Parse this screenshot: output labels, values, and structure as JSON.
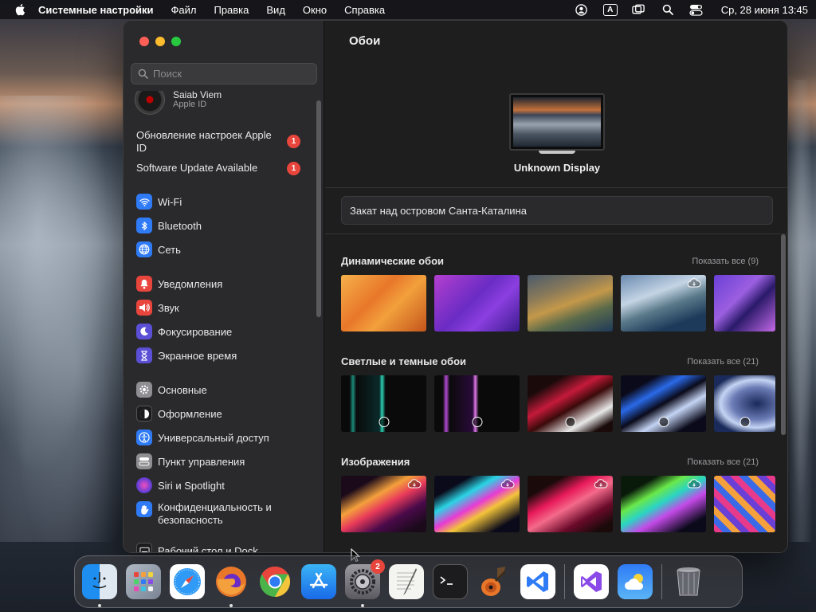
{
  "menubar": {
    "app_name": "Системные настройки",
    "items": [
      "Файл",
      "Правка",
      "Вид",
      "Окно",
      "Справка"
    ],
    "input_source": "A",
    "clock": "Ср, 28 июня  13:45"
  },
  "sidebar": {
    "search_placeholder": "Поиск",
    "account": {
      "name": "Saiab Viem",
      "sub": "Apple ID"
    },
    "notices": [
      {
        "label": "Обновление настроек Apple ID",
        "badge": "1"
      },
      {
        "label": "Software Update Available",
        "badge": "1"
      }
    ],
    "items": [
      {
        "label": "Wi-Fi",
        "icon": "wifi-icon",
        "color": "#2f7bf6"
      },
      {
        "label": "Bluetooth",
        "icon": "bluetooth-icon",
        "color": "#2f7bf6"
      },
      {
        "label": "Сеть",
        "icon": "globe-icon",
        "color": "#2f7bf6"
      },
      {
        "label": "Уведомления",
        "icon": "bell-icon",
        "color": "#e8453c"
      },
      {
        "label": "Звук",
        "icon": "speaker-icon",
        "color": "#e8453c"
      },
      {
        "label": "Фокусирование",
        "icon": "moon-icon",
        "color": "#5b4fd6"
      },
      {
        "label": "Экранное время",
        "icon": "hourglass-icon",
        "color": "#5b4fd6"
      },
      {
        "label": "Основные",
        "icon": "gear-icon",
        "color": "#8e8e93"
      },
      {
        "label": "Оформление",
        "icon": "appearance-icon",
        "color": "#1c1c1e"
      },
      {
        "label": "Универсальный доступ",
        "icon": "accessibility-icon",
        "color": "#2f7bf6"
      },
      {
        "label": "Пункт управления",
        "icon": "control-center-icon",
        "color": "#8e8e93"
      },
      {
        "label": "Siri и Spotlight",
        "icon": "siri-icon",
        "color": "#a13fd6"
      },
      {
        "label": "Конфиденциальность и безопасность",
        "icon": "hand-icon",
        "color": "#2f7bf6"
      },
      {
        "label": "Рабочий стол и Dock",
        "icon": "dock-icon",
        "color": "#1c1c1e"
      }
    ]
  },
  "content": {
    "title": "Обои",
    "display_name": "Unknown Display",
    "wallpaper_name": "Закат над островом Санта-Каталина",
    "sections": [
      {
        "title": "Динамические обои",
        "show_all": "Показать все (9)"
      },
      {
        "title": "Светлые и темные обои",
        "show_all": "Показать все (21)"
      },
      {
        "title": "Изображения",
        "show_all": "Показать все (21)"
      }
    ]
  },
  "dock": {
    "apps": [
      "Finder",
      "Launchpad",
      "Safari",
      "Firefox",
      "Chrome",
      "App Store",
      "System Settings",
      "TextEdit",
      "Terminal",
      "GarageBand",
      "Visual Studio Code",
      "Visual Studio",
      "Weather",
      "Trash"
    ],
    "settings_badge": "2"
  }
}
